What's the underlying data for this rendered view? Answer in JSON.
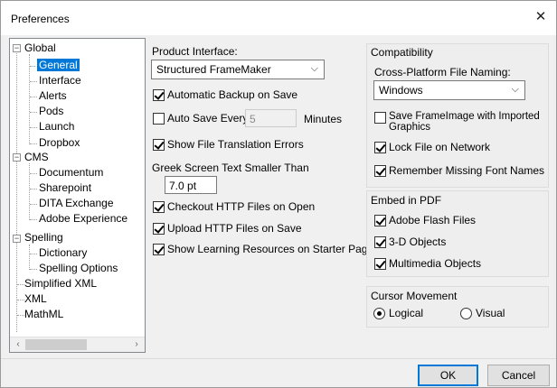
{
  "window": {
    "title": "Preferences",
    "close_glyph": "✕"
  },
  "tree": {
    "nodes": [
      {
        "label": "Global"
      },
      {
        "label": "General"
      },
      {
        "label": "Interface"
      },
      {
        "label": "Alerts"
      },
      {
        "label": "Pods"
      },
      {
        "label": "Launch"
      },
      {
        "label": "Dropbox"
      },
      {
        "label": "CMS"
      },
      {
        "label": "Documentum"
      },
      {
        "label": "Sharepoint"
      },
      {
        "label": "DITA Exchange"
      },
      {
        "label": "Adobe Experience"
      },
      {
        "label": "Spelling"
      },
      {
        "label": "Dictionary"
      },
      {
        "label": "Spelling Options"
      },
      {
        "label": "Simplified XML"
      },
      {
        "label": "XML"
      },
      {
        "label": "MathML"
      }
    ],
    "selected": "General",
    "scroll_left": "‹",
    "scroll_right": "›"
  },
  "general": {
    "product_interface_label": "Product Interface:",
    "product_interface_value": "Structured FrameMaker",
    "automatic_backup": "Automatic Backup on Save",
    "auto_save": "Auto Save Every",
    "auto_save_value": "5",
    "auto_save_unit": "Minutes",
    "show_translation_errors": "Show File Translation Errors",
    "greek_label": "Greek Screen Text Smaller Than",
    "greek_value": "7.0 pt",
    "checkout_http": "Checkout HTTP Files on Open",
    "upload_http": "Upload HTTP Files on Save",
    "show_learning": "Show Learning Resources on Starter Page"
  },
  "compatibility": {
    "title": "Compatibility",
    "naming_label": "Cross-Platform File Naming:",
    "naming_value": "Windows",
    "save_frameimage_line1": "Save FrameImage with Imported",
    "save_frameimage_line2": "Graphics",
    "lock_file": "Lock File on Network",
    "remember_fonts": "Remember Missing Font Names"
  },
  "embed_pdf": {
    "title": "Embed in PDF",
    "flash": "Adobe Flash Files",
    "objects3d": "3-D Objects",
    "multimedia": "Multimedia Objects"
  },
  "cursor": {
    "title": "Cursor Movement",
    "logical": "Logical",
    "visual": "Visual",
    "selected": "Logical"
  },
  "buttons": {
    "ok": "OK",
    "cancel": "Cancel"
  },
  "colors": {
    "selection": "#0078d7",
    "dialog_bg": "#f0f0f0"
  }
}
